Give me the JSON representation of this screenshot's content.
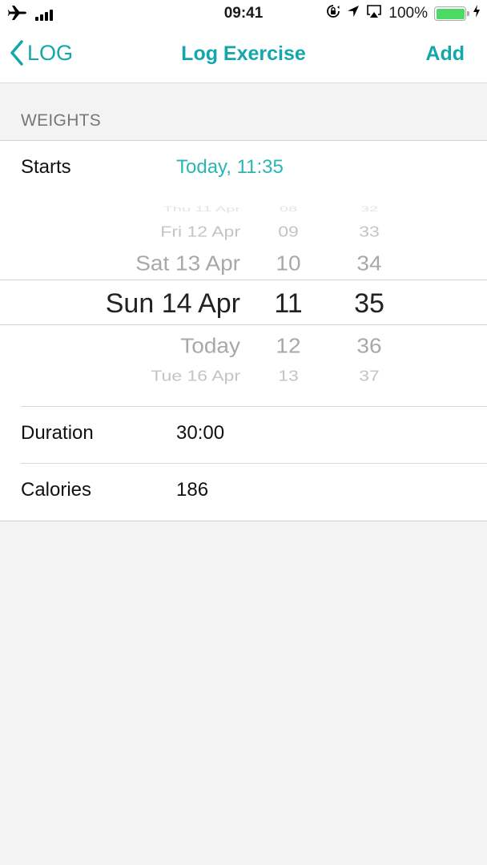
{
  "status_bar": {
    "time": "09:41",
    "battery_percent": "100%",
    "battery_level": 1.0,
    "icons": [
      "airplane-icon",
      "signal-icon",
      "orientation-lock-icon",
      "location-icon",
      "airplay-icon",
      "battery-icon",
      "charging-icon"
    ]
  },
  "nav": {
    "back_label": "LOG",
    "title": "Log Exercise",
    "add_label": "Add",
    "accent_color": "#12a8ab"
  },
  "section": {
    "title": "WEIGHTS"
  },
  "form": {
    "starts": {
      "label": "Starts",
      "value": "Today, 11:35"
    },
    "duration": {
      "label": "Duration",
      "value": "30:00"
    },
    "calories": {
      "label": "Calories",
      "value": "186"
    }
  },
  "picker": {
    "dates": [
      "Thu 11 Apr",
      "Fri 12 Apr",
      "Sat 13 Apr",
      "Sun 14 Apr",
      "Today",
      "Tue 16 Apr"
    ],
    "hours": [
      "08",
      "09",
      "10",
      "11",
      "12",
      "13"
    ],
    "minutes": [
      "32",
      "33",
      "34",
      "35",
      "36",
      "37"
    ],
    "selected": {
      "date": "Sun 14 Apr",
      "hour": "11",
      "minute": "35"
    }
  }
}
